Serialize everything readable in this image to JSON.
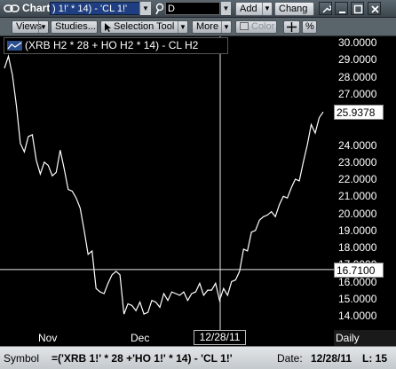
{
  "titlebar": {
    "title": "Chart",
    "symbol_value": ") 1!' * 14) - 'CL 1!'",
    "frequency_value": "D",
    "add_label": "Add",
    "change_label": "Chang"
  },
  "toolbar": {
    "views_label": "Views",
    "studies_label": "Studies...",
    "selection_tool_label": "Selection Tool",
    "more_label": "More",
    "color_label": "Color",
    "percent_label": "%"
  },
  "legend": {
    "text": "(XRB H2 * 28 + HO H2 * 14) - CL H2"
  },
  "chart_data": {
    "type": "line",
    "y_ticks": [
      "30.0000",
      "29.0000",
      "28.0000",
      "27.0000",
      "26.0000",
      "24.0000",
      "23.0000",
      "22.0000",
      "21.0000",
      "20.0000",
      "19.0000",
      "18.0000",
      "17.0000",
      "16.0000",
      "15.0000",
      "14.0000"
    ],
    "ylim": [
      13.5,
      30.5
    ],
    "x_ticks": [
      "Nov",
      "Dec"
    ],
    "last_value_label": "25.9378",
    "crosshair_value_label": "16.7100",
    "crosshair_date_label": "12/28/11",
    "crosshair_value": 16.71,
    "frequency_label": "Daily",
    "series": [
      {
        "values": [
          28.5,
          29.2,
          28.1,
          26.3,
          24.1,
          23.6,
          24.5,
          24.6,
          23.1,
          22.3,
          23.0,
          22.8,
          22.2,
          22.4,
          23.7,
          22.6,
          21.4,
          21.3,
          20.9,
          20.3,
          19.0,
          17.6,
          17.8,
          15.6,
          15.4,
          15.3,
          15.9,
          16.4,
          16.6,
          16.4,
          14.1,
          14.7,
          14.6,
          14.3,
          14.8,
          14.1,
          14.2,
          14.9,
          14.8,
          14.5,
          15.3,
          14.9,
          15.4,
          15.3,
          15.2,
          15.4,
          14.9,
          15.3,
          15.4,
          15.9,
          15.2,
          15.5,
          15.5,
          15.9,
          14.9,
          15.6,
          15.2,
          16.0,
          16.1,
          16.6,
          17.9,
          17.8,
          18.9,
          19.0,
          19.6,
          19.8,
          19.9,
          20.1,
          19.8,
          20.5,
          21.0,
          20.9,
          21.5,
          22.0,
          21.9,
          23.0,
          24.0,
          25.2,
          24.7,
          25.6,
          25.94
        ]
      }
    ]
  },
  "statusbar": {
    "symbol_label": "Symbol",
    "symbol_value": "=('XRB 1!' * 28 +'HO 1!' * 14) - 'CL 1!'",
    "date_label": "Date:",
    "date_value": "12/28/11",
    "extra_label": "L: 15"
  },
  "colors": {
    "plot_line": "#ffffff",
    "chart_background": "#000000",
    "titlebar": "#4a545b",
    "symbol_input": "#1f3f82"
  }
}
